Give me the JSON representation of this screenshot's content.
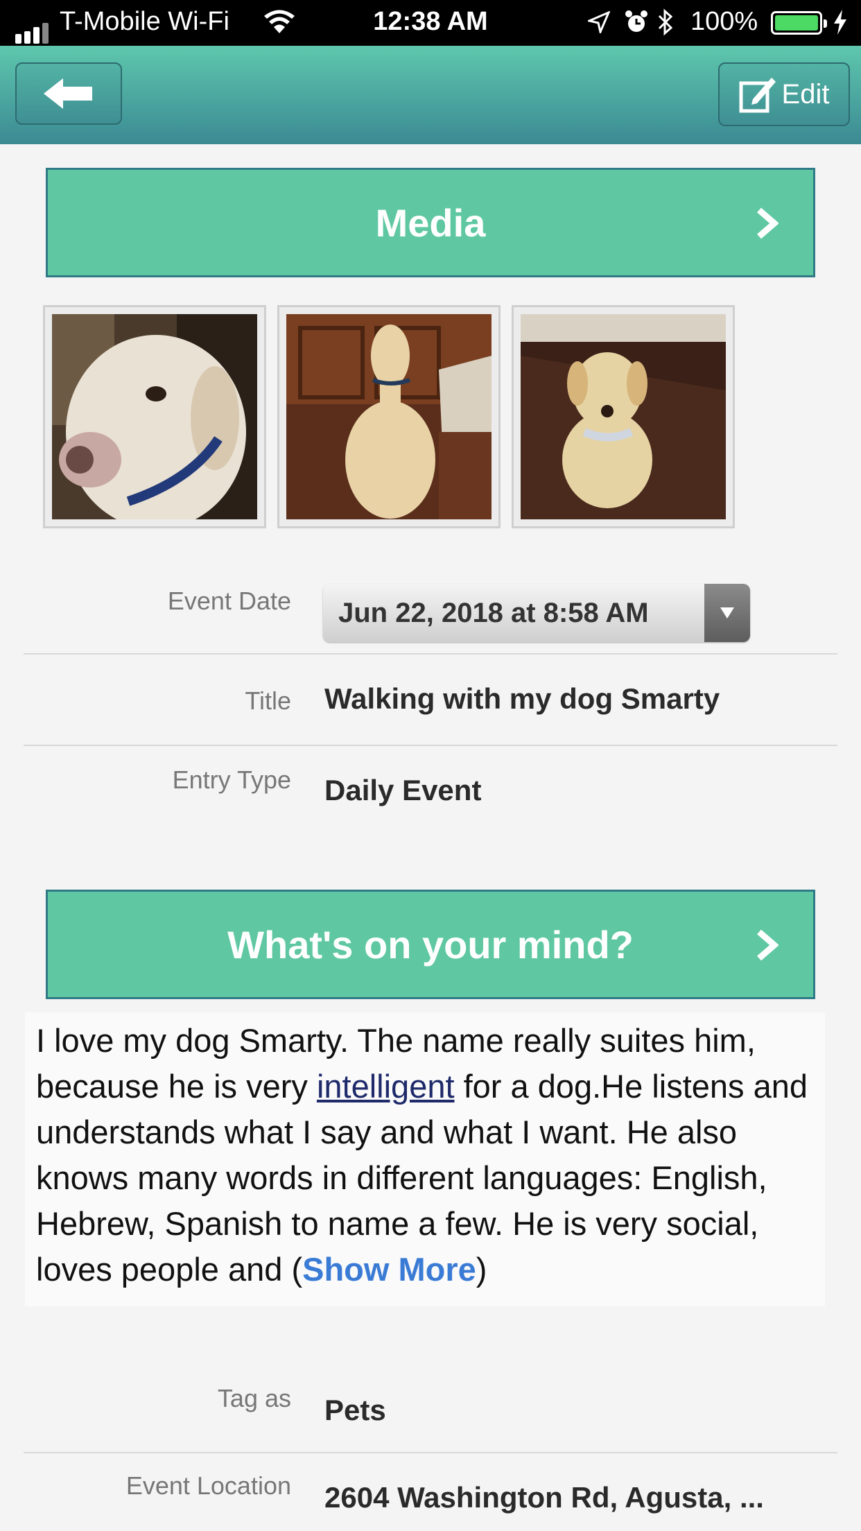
{
  "status_bar": {
    "carrier": "T-Mobile Wi-Fi",
    "time": "12:38 AM",
    "battery_percent": "100%"
  },
  "nav": {
    "edit_label": "Edit"
  },
  "media": {
    "header": "Media",
    "photo_count": 3
  },
  "details": {
    "event_date_label": "Event Date",
    "event_date_value": "Jun 22, 2018 at 8:58 AM",
    "title_label": "Title",
    "title_value": "Walking with my dog Smarty",
    "entry_type_label": "Entry Type",
    "entry_type_value": "Daily Event"
  },
  "mind": {
    "header": "What's on your mind?",
    "text_before": "I love my dog Smarty. The name really suites him, because he is very ",
    "link_word": "intelligent",
    "text_after": " for a dog.He listens and understands what I say and what I want. He also knows many words in different languages: English, Hebrew, Spanish to name a few. He is very social, loves people and (",
    "show_more": "Show More",
    "close_paren": ")"
  },
  "tags": {
    "tag_label": "Tag as",
    "tag_value": "Pets",
    "location_label": "Event Location",
    "location_value": "2604 Washington Rd, Agusta, ..."
  },
  "colors": {
    "header_green": "#5fc8a3",
    "nav_gradient_top": "#5ec7ad",
    "nav_gradient_bottom": "#3b8a93",
    "link_blue": "#3a7bd5"
  }
}
